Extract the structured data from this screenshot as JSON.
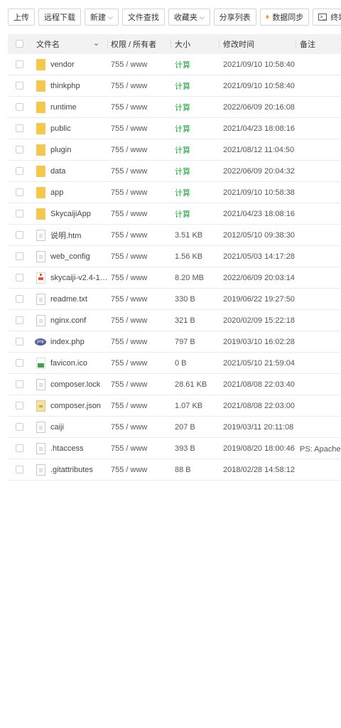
{
  "toolbar": {
    "upload": "上传",
    "remote_download": "远程下载",
    "new": "新建",
    "file_search": "文件查找",
    "favorites": "收藏夹",
    "share_list": "分享列表",
    "data_sync": "数据同步",
    "terminal": "终端"
  },
  "header": {
    "name": "文件名",
    "perm": "权限 / 所有者",
    "size": "大小",
    "mtime": "修改时间",
    "note": "备注"
  },
  "files": [
    {
      "name": "vendor",
      "type": "folder",
      "perm": "755 / www",
      "size": "计算",
      "mtime": "2021/09/10 10:58:40",
      "note": ""
    },
    {
      "name": "thinkphp",
      "type": "folder",
      "perm": "755 / www",
      "size": "计算",
      "mtime": "2021/09/10 10:58:40",
      "note": ""
    },
    {
      "name": "runtime",
      "type": "folder",
      "perm": "755 / www",
      "size": "计算",
      "mtime": "2022/06/09 20:16:08",
      "note": ""
    },
    {
      "name": "public",
      "type": "folder",
      "perm": "755 / www",
      "size": "计算",
      "mtime": "2021/04/23 18:08:16",
      "note": ""
    },
    {
      "name": "plugin",
      "type": "folder",
      "perm": "755 / www",
      "size": "计算",
      "mtime": "2021/08/12 11:04:50",
      "note": ""
    },
    {
      "name": "data",
      "type": "folder",
      "perm": "755 / www",
      "size": "计算",
      "mtime": "2022/06/09 20:04:32",
      "note": ""
    },
    {
      "name": "app",
      "type": "folder",
      "perm": "755 / www",
      "size": "计算",
      "mtime": "2021/09/10 10:58:38",
      "note": ""
    },
    {
      "name": "SkycaijiApp",
      "type": "folder",
      "perm": "755 / www",
      "size": "计算",
      "mtime": "2021/04/23 18:08:16",
      "note": ""
    },
    {
      "name": "说明.htm",
      "type": "doc",
      "perm": "755 / www",
      "size": "3.51 KB",
      "mtime": "2012/05/10 09:38:30",
      "note": ""
    },
    {
      "name": "web_config",
      "type": "doc",
      "perm": "755 / www",
      "size": "1.56 KB",
      "mtime": "2021/05/03 14:17:28",
      "note": ""
    },
    {
      "name": "skycaiji-v2.4-1…",
      "type": "zip",
      "perm": "755 / www",
      "size": "8.20 MB",
      "mtime": "2022/06/09 20:03:14",
      "note": ""
    },
    {
      "name": "readme.txt",
      "type": "doc",
      "perm": "755 / www",
      "size": "330 B",
      "mtime": "2019/06/22 19:27:50",
      "note": ""
    },
    {
      "name": "nginx.conf",
      "type": "doc",
      "perm": "755 / www",
      "size": "321 B",
      "mtime": "2020/02/09 15:22:18",
      "note": ""
    },
    {
      "name": "index.php",
      "type": "php",
      "perm": "755 / www",
      "size": "797 B",
      "mtime": "2019/03/10 16:02:28",
      "note": ""
    },
    {
      "name": "favicon.ico",
      "type": "img",
      "perm": "755 / www",
      "size": "0 B",
      "mtime": "2021/05/10 21:59:04",
      "note": ""
    },
    {
      "name": "composer.lock",
      "type": "doc",
      "perm": "755 / www",
      "size": "28.61 KB",
      "mtime": "2021/08/08 22:03:40",
      "note": ""
    },
    {
      "name": "composer.json",
      "type": "json",
      "perm": "755 / www",
      "size": "1.07 KB",
      "mtime": "2021/08/08 22:03:00",
      "note": ""
    },
    {
      "name": "caiji",
      "type": "doc",
      "perm": "755 / www",
      "size": "207 B",
      "mtime": "2019/03/11 20:11:08",
      "note": ""
    },
    {
      "name": ".htaccess",
      "type": "doc",
      "perm": "755 / www",
      "size": "393 B",
      "mtime": "2019/08/20 18:00:46",
      "note": "PS: Apache用"
    },
    {
      "name": ".gitattributes",
      "type": "doc",
      "perm": "755 / www",
      "size": "88 B",
      "mtime": "2018/02/28 14:58:12",
      "note": ""
    }
  ],
  "icons": {
    "new_caret": "chevron-down-icon",
    "favorites_caret": "chevron-down-icon",
    "data_sync": "gem-icon",
    "terminal": "terminal-icon",
    "last_tool": "document-icon"
  },
  "colors": {
    "calc": "#20a53a",
    "folder": "#f5c74a",
    "header_bg": "#f2f2f2"
  }
}
